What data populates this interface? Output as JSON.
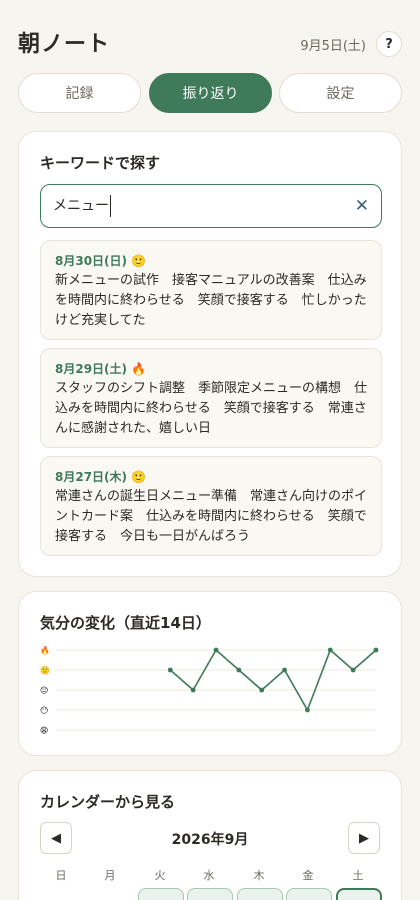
{
  "header": {
    "title": "朝ノート",
    "date": "9月5日(土)",
    "help_label": "?"
  },
  "tabs": [
    {
      "label": "記録",
      "active": false
    },
    {
      "label": "振り返り",
      "active": true
    },
    {
      "label": "設定",
      "active": false
    }
  ],
  "search": {
    "title": "キーワードで探す",
    "value": "メニュー",
    "clear_icon": "close-icon",
    "results": [
      {
        "date": "8月30日(日)",
        "mood": "🙂",
        "text": "新メニューの試作　接客マニュアルの改善案　仕込みを時間内に終わらせる　笑顔で接客する　忙しかったけど充実してた"
      },
      {
        "date": "8月29日(土)",
        "mood": "🔥",
        "text": "スタッフのシフト調整　季節限定メニューの構想　仕込みを時間内に終わらせる　笑顔で接客する　常連さんに感謝された、嬉しい日"
      },
      {
        "date": "8月27日(木)",
        "mood": "🙂",
        "text": "常連さんの誕生日メニュー準備　常連さん向けのポイントカード案　仕込みを時間内に終わらせる　笑顔で接客する　今日も一日がんばろう"
      }
    ]
  },
  "mood_chart": {
    "title": "気分の変化（直近14日）",
    "chart_data": {
      "type": "line",
      "levels": [
        "🔥",
        "🙂",
        "😐",
        "😶",
        "😩"
      ],
      "x": [
        1,
        2,
        3,
        4,
        5,
        6,
        7,
        8,
        9,
        10,
        11,
        12,
        13,
        14
      ],
      "values": [
        null,
        null,
        null,
        null,
        null,
        4,
        3,
        5,
        4,
        3,
        4,
        2,
        5,
        4,
        5
      ],
      "ylim": [
        1,
        5
      ],
      "color": "#3f7a5a",
      "grid": true
    }
  },
  "calendar": {
    "title": "カレンダーから見る",
    "month": "2026年9月",
    "prev_icon": "triangle-left-icon",
    "next_icon": "triangle-right-icon",
    "weekdays": [
      "日",
      "月",
      "火",
      "水",
      "木",
      "金",
      "土"
    ]
  }
}
